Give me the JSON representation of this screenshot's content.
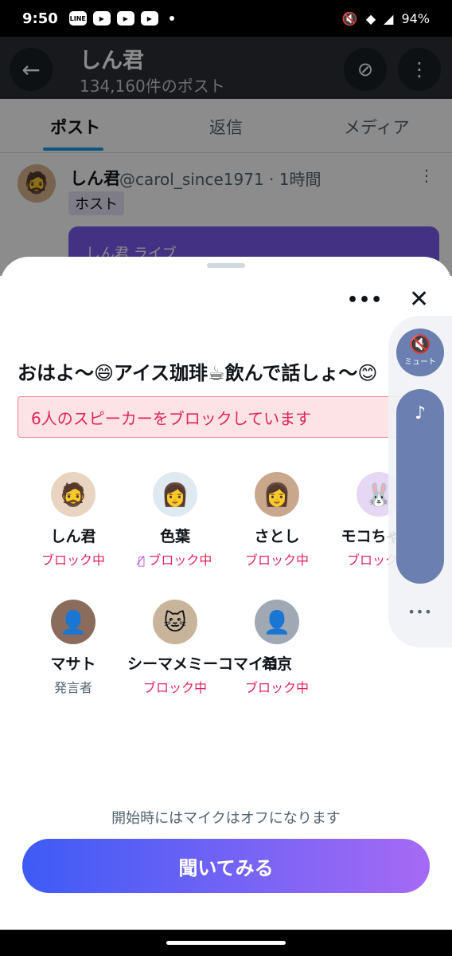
{
  "status_bar": {
    "time": "9:50",
    "battery": "94%",
    "icons": [
      "line-icon",
      "youtube-icon",
      "youtube-icon",
      "youtube-icon"
    ]
  },
  "header": {
    "title": "しん君",
    "subtitle": "134,160件のポスト"
  },
  "tabs": [
    {
      "label": "ポスト",
      "active": true
    },
    {
      "label": "返信"
    },
    {
      "label": "メディア"
    }
  ],
  "tweet": {
    "name": "しん君",
    "handle": "@carol_since1971 · 1時間",
    "host_tag": "ホスト",
    "card_text": "しん君 ライブ"
  },
  "sheet": {
    "title": "おはよ〜😄アイス珈琲☕飲んで話しょ〜😊",
    "banner": "6人のスピーカーをブロックしています",
    "mute_label": "ミュート",
    "note": "開始時にはマイクはオフになります",
    "listen_button": "聞いてみる"
  },
  "speakers": [
    {
      "name": "しん君",
      "status": "ブロック中",
      "avatar": "🧔",
      "color": "#e8d4c0"
    },
    {
      "name": "色葉",
      "status": "ブロック中",
      "avatar": "👩",
      "color": "#dfe9f0",
      "mic_off": true
    },
    {
      "name": "さとし",
      "status": "ブロック中",
      "avatar": "👩",
      "color": "#c9a78d"
    },
    {
      "name": "モコちゃん",
      "status": "ブロック中",
      "avatar": "🐰",
      "color": "#e6d8f5"
    },
    {
      "name": "マサト",
      "status": "発言者",
      "avatar": "👤",
      "color": "#8a6b5c",
      "role": true
    },
    {
      "name": "シーマメミーコマイコ",
      "status": "ブロック中",
      "avatar": "🐱",
      "color": "#c7b49a"
    },
    {
      "name": "希京",
      "status": "ブロック中",
      "avatar": "👤",
      "color": "#9fa8b3"
    }
  ]
}
